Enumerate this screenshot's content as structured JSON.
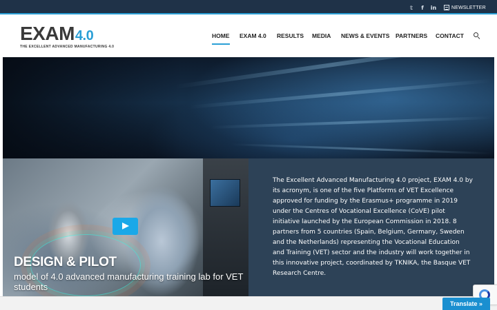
{
  "topbar": {
    "social_icons": [
      "twitter-icon",
      "facebook-icon",
      "linkedin-icon"
    ],
    "twitter_glyph": "𝕥",
    "facebook_glyph": "f",
    "linkedin_glyph": "in",
    "newsletter_label": "NEWSLETTER"
  },
  "brand": {
    "logo_main": "EXAM",
    "logo_version": "4.0",
    "logo_tagline": "THE EXCELLENT ADVANCED MANUFACTURING 4.0",
    "accent_color": "#2a9fd6",
    "dark_color": "#2d4257"
  },
  "nav": {
    "items": [
      {
        "label": "HOME",
        "active": true
      },
      {
        "label": "EXAM 4.0",
        "active": false
      },
      {
        "label": "RESULTS",
        "active": false
      },
      {
        "label": "MEDIA",
        "active": false
      },
      {
        "label": "NEWS & EVENTS",
        "active": false
      },
      {
        "label": "PARTNERS",
        "active": false
      },
      {
        "label": "CONTACT",
        "active": false
      }
    ],
    "search_icon": "search-icon"
  },
  "video": {
    "title": "DESIGN & PILOT",
    "subtitle": "model of 4.0 advanced manufacturing training lab for VET students",
    "play_icon": "play-icon"
  },
  "info": {
    "text": "The Excellent Advanced Manufacturing 4.0 project, EXAM 4.0 by its acronym, is one of the five Platforms of VET Excellence approved for funding by the Erasmus+ programme in 2019 under the Centres of Vocational Excellence (CoVE) pilot initiative launched by the European Commission in 2018. 8 partners from 5 countries (Spain, Belgium, Germany, Sweden and the Netherlands) representing the Vocational Education and Training (VET) sector and the industry will work together in this innovative project, coordinated by TKNIKA, the Basque VET Research Centre."
  },
  "translate": {
    "label": "Translate »"
  }
}
